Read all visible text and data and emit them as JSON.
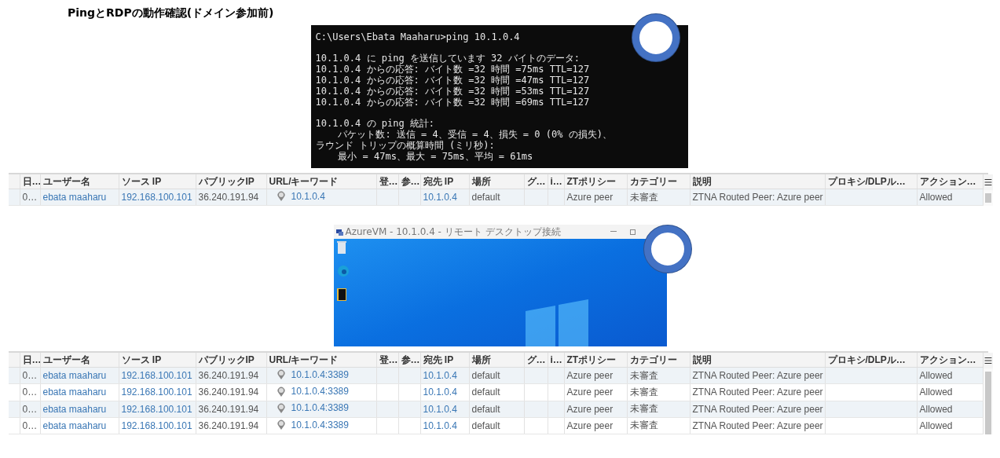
{
  "title": "PingとRDPの動作確認(ドメイン参加前)",
  "terminal": {
    "blocks": [
      [
        "C:\\Users\\Ebata Maaharu>ping 10.1.0.4"
      ],
      [
        "10.1.0.4 に ping を送信しています 32 バイトのデータ:",
        "10.1.0.4 からの応答: バイト数 =32 時間 =75ms TTL=127",
        "10.1.0.4 からの応答: バイト数 =32 時間 =47ms TTL=127",
        "10.1.0.4 からの応答: バイト数 =32 時間 =53ms TTL=127",
        "10.1.0.4 からの応答: バイト数 =32 時間 =69ms TTL=127"
      ],
      [
        "10.1.0.4 の ping 統計:",
        "    パケット数: 送信 = 4、受信 = 4、損失 = 0 (0% の損失)、",
        "ラウンド トリップの概算時間 (ミリ秒):",
        "    最小 = 47ms、最大 = 75ms、平均 = 61ms"
      ]
    ]
  },
  "tables": [
    {
      "columns": [
        {
          "label": "日…",
          "kind": "text"
        },
        {
          "label": "ユーザー名",
          "kind": "link"
        },
        {
          "label": "ソース IP",
          "kind": "link"
        },
        {
          "label": "パブリックIP",
          "kind": "text"
        },
        {
          "label": "URL/キーワード",
          "kind": "pin"
        },
        {
          "label": "登…",
          "kind": "text"
        },
        {
          "label": "参…",
          "kind": "text"
        },
        {
          "label": "宛先 IP",
          "kind": "link"
        },
        {
          "label": "場所",
          "kind": "text"
        },
        {
          "label": "グ…",
          "kind": "text"
        },
        {
          "label": "i…",
          "kind": "text"
        },
        {
          "label": "ZTポリシー",
          "kind": "text"
        },
        {
          "label": "カテゴリー",
          "kind": "text"
        },
        {
          "label": "説明",
          "kind": "text"
        },
        {
          "label": "プロキシ/DLPル…",
          "kind": "text"
        },
        {
          "label": "アクション…",
          "kind": "text"
        }
      ],
      "rows": [
        [
          "0…",
          "ebata maaharu",
          "192.168.100.101",
          "36.240.191.94",
          "10.1.0.4",
          "",
          "",
          "10.1.0.4",
          "default",
          "",
          "",
          "Azure peer",
          "未審査",
          "ZTNA Routed Peer: Azure peer",
          "",
          "Allowed"
        ]
      ]
    },
    {
      "columns": [
        {
          "label": "日…",
          "kind": "text"
        },
        {
          "label": "ユーザー名",
          "kind": "link"
        },
        {
          "label": "ソース IP",
          "kind": "link"
        },
        {
          "label": "パブリックIP",
          "kind": "text"
        },
        {
          "label": "URL/キーワード",
          "kind": "pin"
        },
        {
          "label": "登…",
          "kind": "text"
        },
        {
          "label": "参…",
          "kind": "text"
        },
        {
          "label": "宛先 IP",
          "kind": "link"
        },
        {
          "label": "場所",
          "kind": "text"
        },
        {
          "label": "グ…",
          "kind": "text"
        },
        {
          "label": "i…",
          "kind": "text"
        },
        {
          "label": "ZTポリシー",
          "kind": "text"
        },
        {
          "label": "カテゴリー",
          "kind": "text"
        },
        {
          "label": "説明",
          "kind": "text"
        },
        {
          "label": "プロキシ/DLPル…",
          "kind": "text"
        },
        {
          "label": "アクション…",
          "kind": "text"
        }
      ],
      "rows": [
        [
          "0…",
          "ebata maaharu",
          "192.168.100.101",
          "36.240.191.94",
          "10.1.0.4:3389",
          "",
          "",
          "10.1.0.4",
          "default",
          "",
          "",
          "Azure peer",
          "未審査",
          "ZTNA Routed Peer: Azure peer",
          "",
          "Allowed"
        ],
        [
          "0…",
          "ebata maaharu",
          "192.168.100.101",
          "36.240.191.94",
          "10.1.0.4:3389",
          "",
          "",
          "10.1.0.4",
          "default",
          "",
          "",
          "Azure peer",
          "未審査",
          "ZTNA Routed Peer: Azure peer",
          "",
          "Allowed"
        ],
        [
          "0…",
          "ebata maaharu",
          "192.168.100.101",
          "36.240.191.94",
          "10.1.0.4:3389",
          "",
          "",
          "10.1.0.4",
          "default",
          "",
          "",
          "Azure peer",
          "未審査",
          "ZTNA Routed Peer: Azure peer",
          "",
          "Allowed"
        ],
        [
          "0…",
          "ebata maaharu",
          "192.168.100.101",
          "36.240.191.94",
          "10.1.0.4:3389",
          "",
          "",
          "10.1.0.4",
          "default",
          "",
          "",
          "Azure peer",
          "未審査",
          "ZTNA Routed Peer: Azure peer",
          "",
          "Allowed"
        ]
      ]
    }
  ],
  "rdp_window": {
    "title": "AzureVM - 10.1.0.4 - リモート デスクトップ接続"
  }
}
